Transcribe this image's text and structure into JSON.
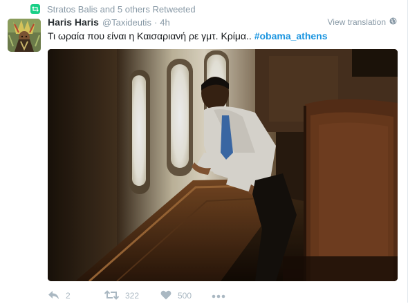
{
  "context": {
    "icon": "retweet-icon",
    "text": "Stratos Balis and 5 others Retweeted",
    "color": "#19cf86"
  },
  "tweet": {
    "fullname": "Haris Haris",
    "username": "@Taxideutis",
    "separator": "·",
    "time": "4h",
    "translate_label": "View translation",
    "text": "Τι ωραία που είναι η Καισαριανή ρε γμτ. Κρίμα.. ",
    "hashtag": "#obama_athens",
    "hashtag_color": "#1b95e0"
  },
  "actions": {
    "reply": {
      "icon": "reply-icon",
      "count": "2"
    },
    "retweet": {
      "icon": "retweet-icon",
      "count": "322"
    },
    "like": {
      "icon": "heart-icon",
      "count": "500"
    },
    "more": {
      "icon": "more-dots-icon"
    }
  },
  "colors": {
    "muted": "#8899a6",
    "action": "#aab8c2",
    "border": "#e1e8ed"
  }
}
